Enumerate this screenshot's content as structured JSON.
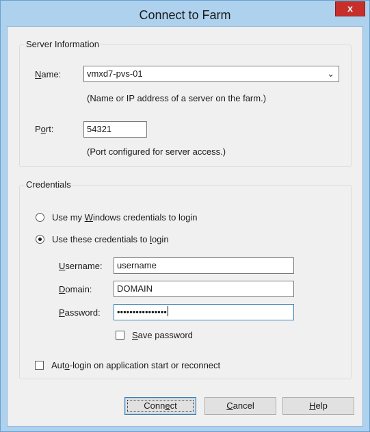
{
  "window": {
    "title": "Connect to Farm",
    "close_glyph": "x"
  },
  "server_info": {
    "group_label": "Server Information",
    "name_label_pre": "",
    "name_label_u": "N",
    "name_label_post": "ame:",
    "name_value": "vmxd7-pvs-01",
    "name_hint": "(Name or IP address of a server on the farm.)",
    "port_label_pre": "P",
    "port_label_u": "o",
    "port_label_post": "rt:",
    "port_value": "54321",
    "port_hint": "(Port configured for server access.)"
  },
  "credentials": {
    "group_label": "Credentials",
    "option_windows_pre": "Use my ",
    "option_windows_u": "W",
    "option_windows_post": "indows credentials to login",
    "option_windows_selected": false,
    "option_these_pre": "Use these credentials to ",
    "option_these_u": "l",
    "option_these_post": "ogin",
    "option_these_selected": true,
    "username_label_pre": "",
    "username_label_u": "U",
    "username_label_post": "sername:",
    "username_value": "username",
    "domain_label_pre": "",
    "domain_label_u": "D",
    "domain_label_post": "omain:",
    "domain_value": "DOMAIN",
    "password_label_pre": "",
    "password_label_u": "P",
    "password_label_post": "assword:",
    "password_masked": "••••••••••••••••",
    "save_password_pre": "",
    "save_password_u": "S",
    "save_password_post": "ave password",
    "save_password_checked": false
  },
  "auto_login": {
    "label_pre": "Aut",
    "label_u": "o",
    "label_post": "-login on application start or reconnect",
    "checked": false
  },
  "buttons": {
    "connect_pre": "Conn",
    "connect_u": "e",
    "connect_post": "ct",
    "cancel_pre": "",
    "cancel_u": "C",
    "cancel_post": "ancel",
    "help_pre": "",
    "help_u": "H",
    "help_post": "elp"
  }
}
